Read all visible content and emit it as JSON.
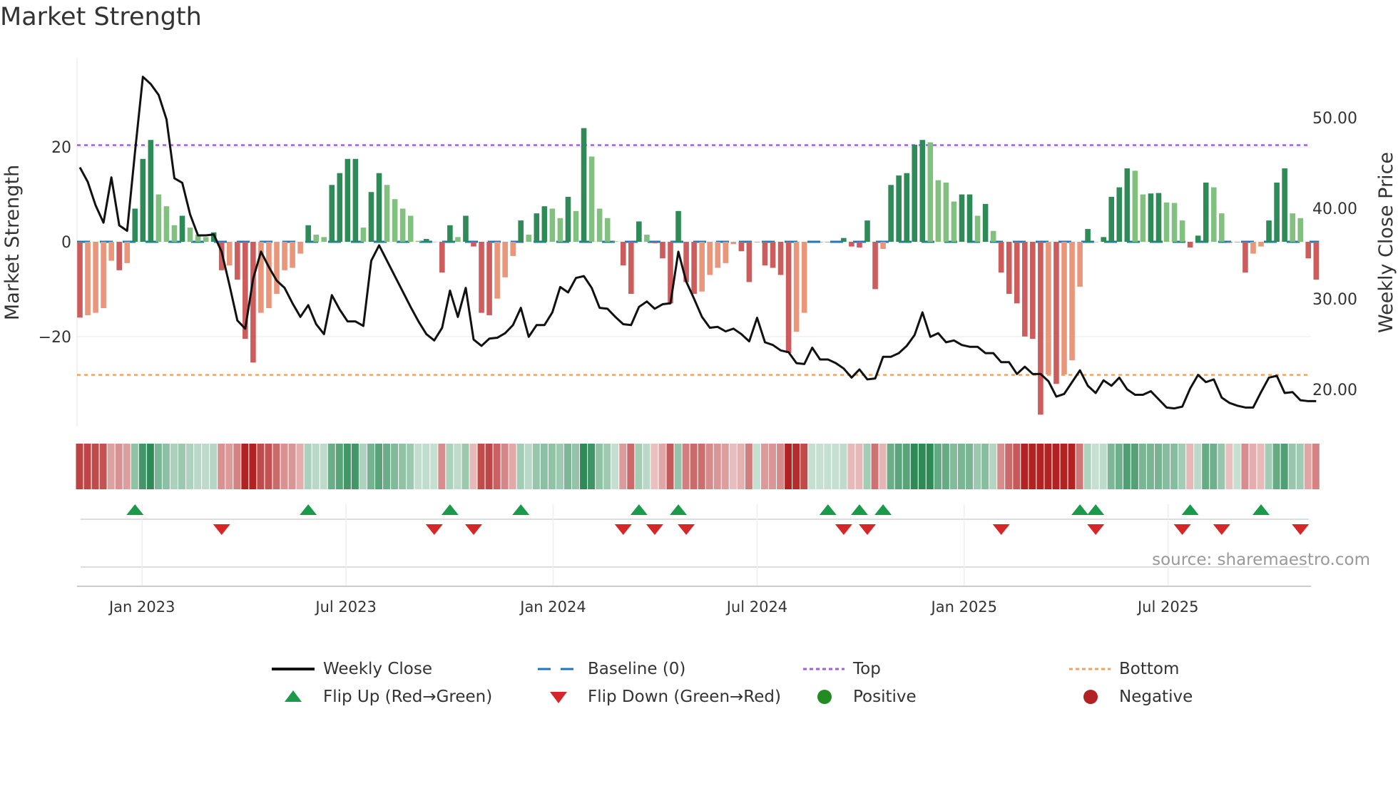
{
  "title": "Market Strength",
  "source": "source: sharemaestro.com",
  "colors": {
    "pos_dark": "#2e8b57",
    "pos_light": "#81c07f",
    "neg_dark": "#cd5c5c",
    "neg_light": "#e9967a",
    "top": "#9b5fe0",
    "bottom": "#f0a35e",
    "baseline": "#1f77b4",
    "close": "#111111",
    "flip_up": "#1a9a4a",
    "flip_down": "#d62728",
    "positive": "#228b22",
    "negative": "#b22222"
  },
  "legend": [
    {
      "key": "close",
      "label": "Weekly Close"
    },
    {
      "key": "baseline",
      "label": "Baseline (0)"
    },
    {
      "key": "top",
      "label": "Top"
    },
    {
      "key": "bottom",
      "label": "Bottom"
    },
    {
      "key": "flip_up",
      "label": "Flip Up (Red→Green)"
    },
    {
      "key": "flip_down",
      "label": "Flip Down (Green→Red)"
    },
    {
      "key": "positive",
      "label": "Positive"
    },
    {
      "key": "negative",
      "label": "Negative"
    }
  ],
  "chart_data": {
    "type": "bar+line",
    "title": "Market Strength",
    "ylabel": "Market Strength",
    "y2label": "Weekly Close Price",
    "ylim": [
      -39,
      39
    ],
    "y2lim": [
      15.9,
      56.6
    ],
    "x_unit": "weeks",
    "yticks": [
      {
        "v": 20,
        "label": "20"
      },
      {
        "v": 0,
        "label": "0"
      },
      {
        "v": -20,
        "label": "−20"
      }
    ],
    "y2ticks": [
      {
        "v": 50,
        "label": "50.00"
      },
      {
        "v": 40,
        "label": "40.00"
      },
      {
        "v": 30,
        "label": "30.00"
      },
      {
        "v": 20,
        "label": "20.00"
      }
    ],
    "xticks": [
      {
        "v": 7.9,
        "label": "Jan 2023"
      },
      {
        "v": 33.8,
        "label": "Jul 2023"
      },
      {
        "v": 60.1,
        "label": "Jan 2024"
      },
      {
        "v": 86.0,
        "label": "Jul 2024"
      },
      {
        "v": 112.3,
        "label": "Jan 2025"
      },
      {
        "v": 138.2,
        "label": "Jul 2025"
      }
    ],
    "top": 20.4,
    "bottom": -28.1,
    "baseline": 0,
    "strength": [
      -16,
      -15.5,
      -15,
      -14,
      -4,
      -6,
      -4.5,
      7,
      17.5,
      21.5,
      10,
      7.5,
      3.5,
      5.5,
      3,
      1.5,
      1,
      2,
      -6,
      -5,
      -8,
      -20.5,
      -25.5,
      -15,
      -14,
      -11,
      -6,
      -5.5,
      -2.5,
      3.5,
      1.5,
      1,
      12,
      14.5,
      17.5,
      17.5,
      3,
      10.5,
      14.5,
      12,
      9,
      7,
      5.5,
      0.2,
      0.6,
      0,
      -6.5,
      3.5,
      1,
      5.5,
      -1,
      -15,
      -15.5,
      -12,
      -7.5,
      -3,
      4.5,
      1.5,
      6,
      7.5,
      7,
      5,
      9.5,
      6.5,
      24,
      18,
      7,
      5,
      0.1,
      -5,
      -11,
      4.3,
      1.5,
      -0.3,
      -3.5,
      -13,
      6.5,
      -8.5,
      -11,
      -10.5,
      -7,
      -5.5,
      -4.5,
      -0.5,
      -2,
      -8.5,
      0,
      -5,
      -5.5,
      -7,
      -23.5,
      -19,
      -15,
      0,
      0,
      0,
      0,
      0.8,
      -1,
      -1.2,
      4.5,
      -10,
      -1.5,
      12,
      14,
      14.5,
      20.5,
      21.5,
      21,
      13,
      12.5,
      8.5,
      10,
      10,
      5.5,
      8,
      2.3,
      -6.5,
      -11,
      -13,
      -20,
      -20.5,
      -36.5,
      -28,
      -30,
      -28,
      -25,
      -9.5,
      2.7,
      0,
      1,
      9.5,
      11.5,
      15.5,
      15,
      10,
      10.2,
      10.3,
      8.3,
      8.2,
      4.5,
      -1.2,
      1.3,
      12.5,
      11.5,
      6,
      -0.2,
      0,
      -6.5,
      -2.5,
      -1,
      4.5,
      12.5,
      15.5,
      6,
      5,
      -3.5,
      -8
    ],
    "close": [
      44.5,
      42.9,
      40.3,
      38.4,
      43.4,
      38.1,
      37.5,
      46.2,
      54.5,
      53.7,
      52.5,
      49.8,
      43.3,
      42.8,
      39.3,
      37.0,
      37.0,
      37.1,
      35.2,
      31.5,
      27.6,
      26.7,
      32.2,
      35.2,
      33.5,
      32.0,
      31.2,
      29.5,
      28.0,
      29.3,
      27.2,
      26.1,
      30.4,
      28.8,
      27.5,
      27.5,
      27.0,
      34.2,
      35.9,
      34.2,
      32.5,
      30.8,
      29.1,
      27.5,
      26.1,
      25.4,
      26.8,
      30.9,
      28.0,
      31.2,
      25.5,
      24.8,
      25.6,
      25.7,
      26.2,
      27.1,
      29.0,
      25.8,
      27.1,
      27.1,
      28.5,
      31.3,
      30.7,
      32.3,
      32.5,
      31.2,
      29.0,
      28.9,
      28.0,
      27.2,
      27.1,
      29.1,
      29.7,
      28.9,
      29.4,
      29.5,
      35.2,
      31.9,
      30.0,
      28.0,
      26.8,
      26.9,
      26.4,
      26.7,
      26.1,
      25.3,
      27.9,
      25.2,
      24.9,
      24.3,
      24.1,
      22.9,
      22.8,
      24.6,
      23.3,
      23.3,
      22.9,
      22.3,
      21.3,
      22.2,
      21.1,
      21.2,
      23.6,
      23.6,
      24.0,
      24.8,
      26.0,
      28.5,
      25.8,
      26.2,
      25.2,
      25.4,
      24.9,
      24.7,
      24.7,
      24.0,
      24.0,
      23.0,
      23.0,
      21.7,
      22.5,
      21.7,
      21.7,
      20.9,
      19.2,
      19.5,
      20.8,
      22.1,
      20.4,
      19.6,
      21.0,
      20.4,
      21.3,
      20.0,
      19.4,
      19.4,
      19.8,
      18.9,
      18.0,
      17.9,
      18.1,
      20.1,
      21.6,
      20.8,
      21.1,
      19.1,
      18.5,
      18.2,
      18.0,
      18.0,
      19.7,
      21.3,
      21.5,
      19.6,
      19.7,
      18.8,
      18.7,
      18.7
    ],
    "flip_up": [
      7,
      29,
      47,
      56,
      71,
      76,
      95,
      99,
      102,
      127,
      129,
      141,
      150
    ],
    "flip_down": [
      18,
      45,
      50,
      69,
      73,
      77,
      97,
      100,
      117,
      129,
      140,
      145,
      155
    ]
  }
}
